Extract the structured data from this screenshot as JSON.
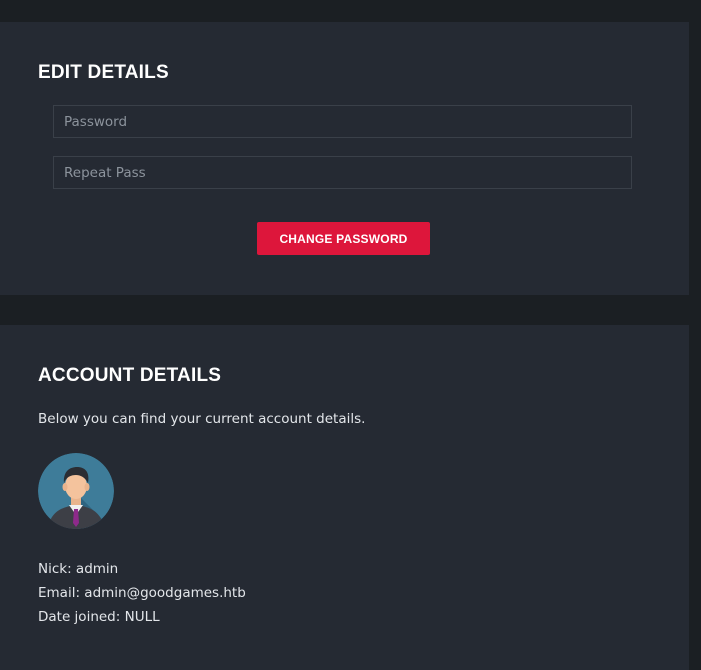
{
  "edit": {
    "heading": "EDIT DETAILS",
    "password_placeholder": "Password",
    "repeat_placeholder": "Repeat Pass",
    "submit_label": "CHANGE PASSWORD"
  },
  "account": {
    "heading": "ACCOUNT DETAILS",
    "intro": "Below you can find your current account details.",
    "avatar_icon": "user-avatar-icon",
    "nick_line": "Nick: admin",
    "email_line": "Email: admin@goodgames.htb",
    "date_line": "Date joined: NULL"
  },
  "colors": {
    "background": "#1b1f23",
    "panel": "#252a33",
    "accent": "#dd163b",
    "text": "#e3e6ea"
  }
}
